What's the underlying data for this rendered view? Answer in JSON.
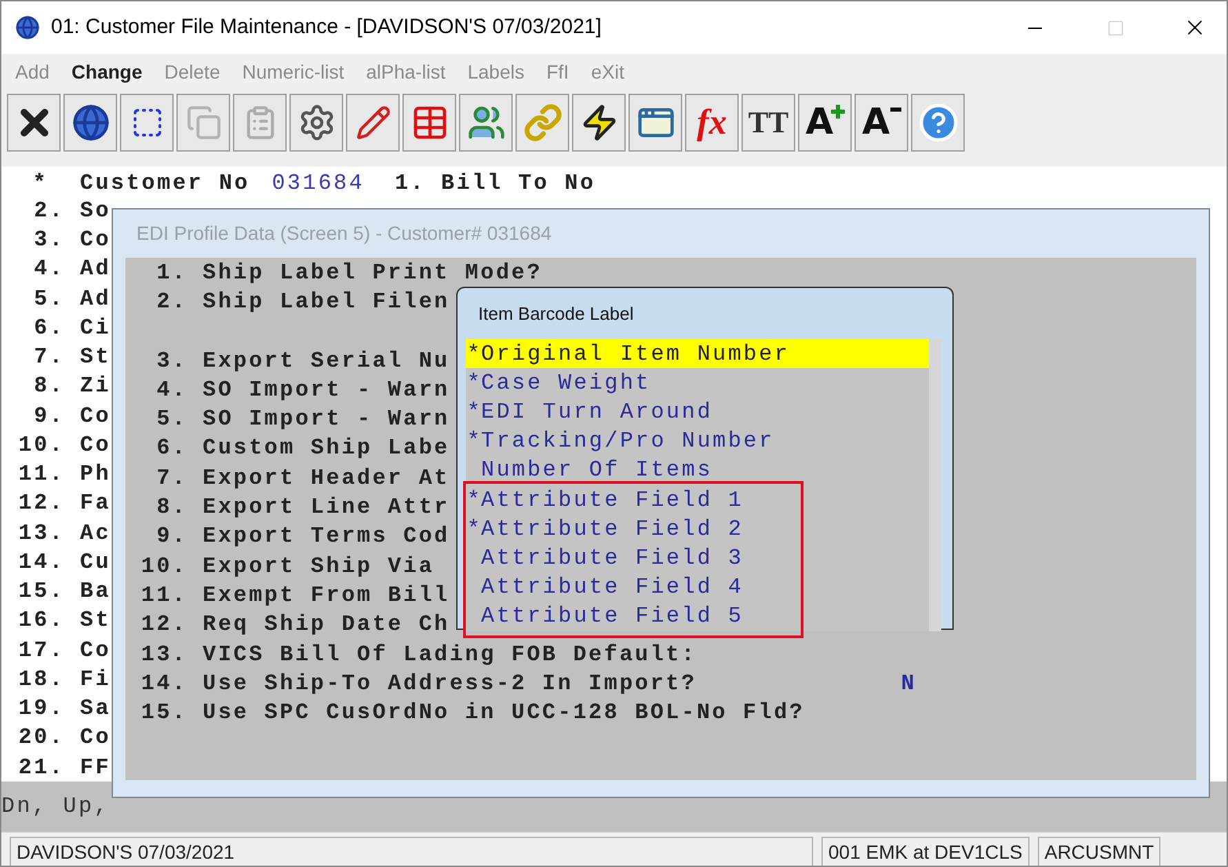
{
  "window": {
    "title": "01: Customer File Maintenance - [DAVIDSON'S 07/03/2021]"
  },
  "menu": [
    {
      "label": "Add",
      "selected": false
    },
    {
      "label": "Change",
      "selected": true
    },
    {
      "label": "Delete",
      "selected": false
    },
    {
      "label": "Numeric-list",
      "selected": false
    },
    {
      "label": "alPha-list",
      "selected": false
    },
    {
      "label": "Labels",
      "selected": false
    },
    {
      "label": "FfI",
      "selected": false
    },
    {
      "label": "eXit",
      "selected": false
    }
  ],
  "toolbar": [
    {
      "kind": "exit",
      "disabled": false
    },
    {
      "kind": "globe",
      "disabled": false
    },
    {
      "kind": "select",
      "disabled": false
    },
    {
      "kind": "copy",
      "disabled": true
    },
    {
      "kind": "paste",
      "disabled": true
    },
    {
      "kind": "settings",
      "disabled": false
    },
    {
      "kind": "edit",
      "disabled": false
    },
    {
      "kind": "table",
      "disabled": false
    },
    {
      "kind": "users",
      "disabled": false
    },
    {
      "kind": "link",
      "disabled": false
    },
    {
      "kind": "lightning",
      "disabled": false
    },
    {
      "kind": "window-lightning",
      "disabled": false
    },
    {
      "kind": "fx",
      "label": "fx",
      "disabled": false
    },
    {
      "kind": "font",
      "label": "TT",
      "disabled": false
    },
    {
      "kind": "font-bigger",
      "label": "A",
      "disabled": false
    },
    {
      "kind": "font-smaller",
      "label": "A",
      "disabled": false
    },
    {
      "kind": "help",
      "disabled": false
    }
  ],
  "terminal": {
    "header": {
      "mark": "*",
      "label": "Customer No",
      "value": "031684",
      "next": "1. Bill To No"
    },
    "lines": [
      {
        "num": "2.",
        "text": "So"
      },
      {
        "num": "3.",
        "text": "Co"
      },
      {
        "num": "4.",
        "text": "Ad"
      },
      {
        "num": "5.",
        "text": "Ad"
      },
      {
        "num": "6.",
        "text": "Ci"
      },
      {
        "num": "7.",
        "text": "St"
      },
      {
        "num": "8.",
        "text": "Zi"
      },
      {
        "num": "9.",
        "text": "Co"
      },
      {
        "num": "10.",
        "text": "Co"
      },
      {
        "num": "11.",
        "text": "Ph"
      },
      {
        "num": "12.",
        "text": "Fa"
      },
      {
        "num": "13.",
        "text": "Ac"
      },
      {
        "num": "14.",
        "text": "Cu"
      },
      {
        "num": "15.",
        "text": "Ba"
      },
      {
        "num": "16.",
        "text": "St"
      },
      {
        "num": "17.",
        "text": "Co"
      },
      {
        "num": "18.",
        "text": "Fi"
      },
      {
        "num": "19.",
        "text": "Sa"
      },
      {
        "num": "20.",
        "text": "Co"
      },
      {
        "num": "21.",
        "text": "FF"
      }
    ],
    "prompt": "Dn, Up,"
  },
  "edi_dialog": {
    "title": "EDI Profile Data (Screen 5) - Customer# 031684",
    "groups": [
      [
        {
          "num": "1.",
          "text": "Ship Label Print Mode?"
        },
        {
          "num": "2.",
          "text": "Ship Label Filen"
        }
      ],
      [
        {
          "num": "3.",
          "text": "Export Serial Nu"
        },
        {
          "num": "4.",
          "text": "SO Import - Warn"
        },
        {
          "num": "5.",
          "text": "SO Import - Warn"
        },
        {
          "num": "6.",
          "text": "Custom Ship Labe"
        },
        {
          "num": "7.",
          "text": "Export Header At"
        },
        {
          "num": "8.",
          "text": "Export Line Attr"
        },
        {
          "num": "9.",
          "text": "Export Terms Cod"
        },
        {
          "num": "10.",
          "text": "Export Ship Via"
        },
        {
          "num": "11.",
          "text": "Exempt From Bill"
        },
        {
          "num": "12.",
          "text": "Req Ship Date Ch"
        },
        {
          "num": "13.",
          "text": "VICS Bill Of Lading FOB Default:"
        },
        {
          "num": "14.",
          "text": "Use Ship-To Address-2 In Import?",
          "value": "N"
        },
        {
          "num": "15.",
          "text": "Use SPC CusOrdNo in UCC-128 BOL-No Fld?"
        }
      ]
    ]
  },
  "barcode_dialog": {
    "title": "Item Barcode Label",
    "items": [
      {
        "mark": "*",
        "text": "Original Item Number",
        "selected": true
      },
      {
        "mark": "*",
        "text": "Case Weight",
        "selected": false
      },
      {
        "mark": "*",
        "text": "EDI Turn Around",
        "selected": false
      },
      {
        "mark": "*",
        "text": "Tracking/Pro Number",
        "selected": false
      },
      {
        "text": "Number Of Items",
        "selected": false
      },
      {
        "mark": "*",
        "text": "Attribute Field 1",
        "selected": false
      },
      {
        "mark": "*",
        "text": "Attribute Field 2",
        "selected": false
      },
      {
        "text": "Attribute Field 3",
        "selected": false
      },
      {
        "text": "Attribute Field 4",
        "selected": false
      },
      {
        "text": "Attribute Field 5",
        "selected": false
      }
    ]
  },
  "status_bar": [
    "DAVIDSON'S 07/03/2021",
    "001 EMK at DEV1CLS",
    "ARCUSMNT"
  ]
}
